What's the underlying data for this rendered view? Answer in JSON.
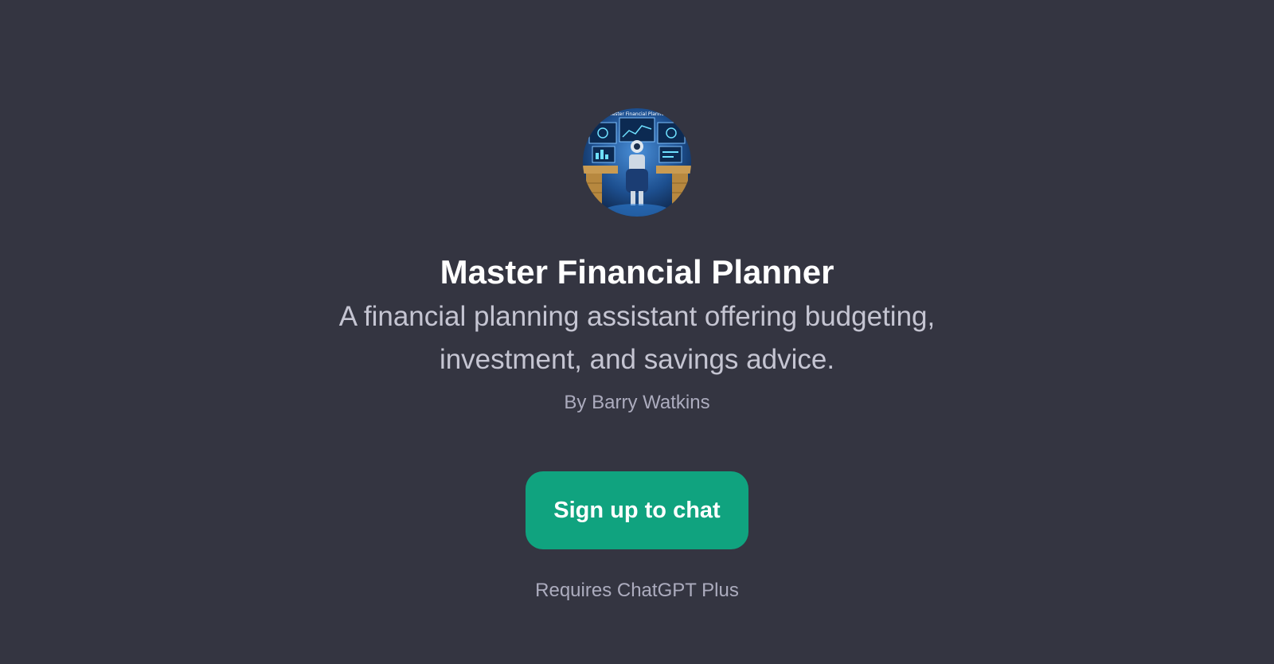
{
  "profile": {
    "avatar_icon": "robot-financial-planner-avatar",
    "title": "Master Financial Planner",
    "description": "A financial planning assistant offering budgeting, investment, and savings advice.",
    "author": "By Barry Watkins"
  },
  "actions": {
    "signup_label": "Sign up to chat",
    "requirement_note": "Requires ChatGPT Plus"
  },
  "colors": {
    "background": "#343541",
    "button": "#10a37f"
  }
}
